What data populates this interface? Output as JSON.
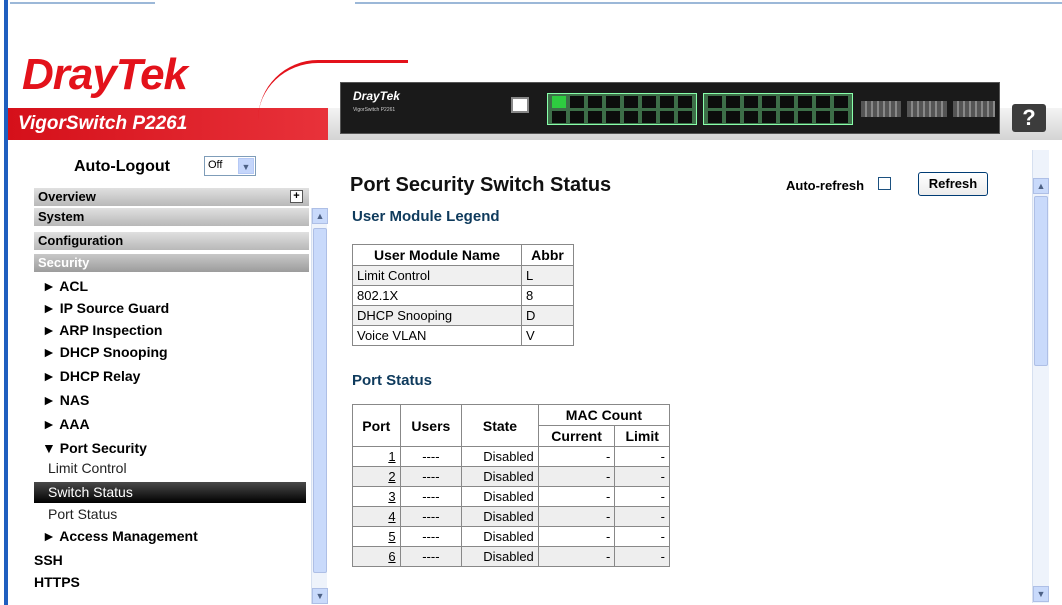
{
  "brand": {
    "logo_text_dray": "Dray",
    "logo_text_tek": "Tek",
    "model": "VigorSwitch P2261",
    "device_logo": "DrayTek",
    "device_subtitle": "VigorSwitch P2261"
  },
  "help": {
    "label": "?"
  },
  "sidebar": {
    "autologout_label": "Auto-Logout",
    "autologout_value": "Off",
    "sections": {
      "overview": "Overview",
      "system": "System",
      "configuration": "Configuration",
      "security": "Security"
    },
    "security_items": [
      "ACL",
      "IP Source Guard",
      "ARP Inspection",
      "DHCP Snooping",
      "DHCP Relay",
      "NAS",
      "AAA"
    ],
    "port_security": "Port Security",
    "port_security_items": [
      "Limit Control",
      "Switch Status",
      "Port Status"
    ],
    "access_management": "Access Management",
    "ssh": "SSH",
    "https": "HTTPS",
    "expand_glyph": "►",
    "collapse_glyph": "▼"
  },
  "main": {
    "title": "Port Security Switch Status",
    "auto_refresh_label": "Auto-refresh",
    "refresh_button": "Refresh",
    "legend_title": "User Module Legend",
    "legend_headers": [
      "User Module Name",
      "Abbr"
    ],
    "legend_rows": [
      [
        "Limit Control",
        "L"
      ],
      [
        "802.1X",
        "8"
      ],
      [
        "DHCP Snooping",
        "D"
      ],
      [
        "Voice VLAN",
        "V"
      ]
    ],
    "port_status_title": "Port Status",
    "status_headers": {
      "port": "Port",
      "users": "Users",
      "state": "State",
      "mac_count": "MAC Count",
      "current": "Current",
      "limit": "Limit"
    },
    "status_rows": [
      [
        "1",
        "----",
        "Disabled",
        "-",
        "-"
      ],
      [
        "2",
        "----",
        "Disabled",
        "-",
        "-"
      ],
      [
        "3",
        "----",
        "Disabled",
        "-",
        "-"
      ],
      [
        "4",
        "----",
        "Disabled",
        "-",
        "-"
      ],
      [
        "5",
        "----",
        "Disabled",
        "-",
        "-"
      ],
      [
        "6",
        "----",
        "Disabled",
        "-",
        "-"
      ]
    ]
  },
  "colors": {
    "brand_red": "#e3121b",
    "section_title": "#0e3a5c",
    "frame_blue": "#1f5fbf"
  }
}
